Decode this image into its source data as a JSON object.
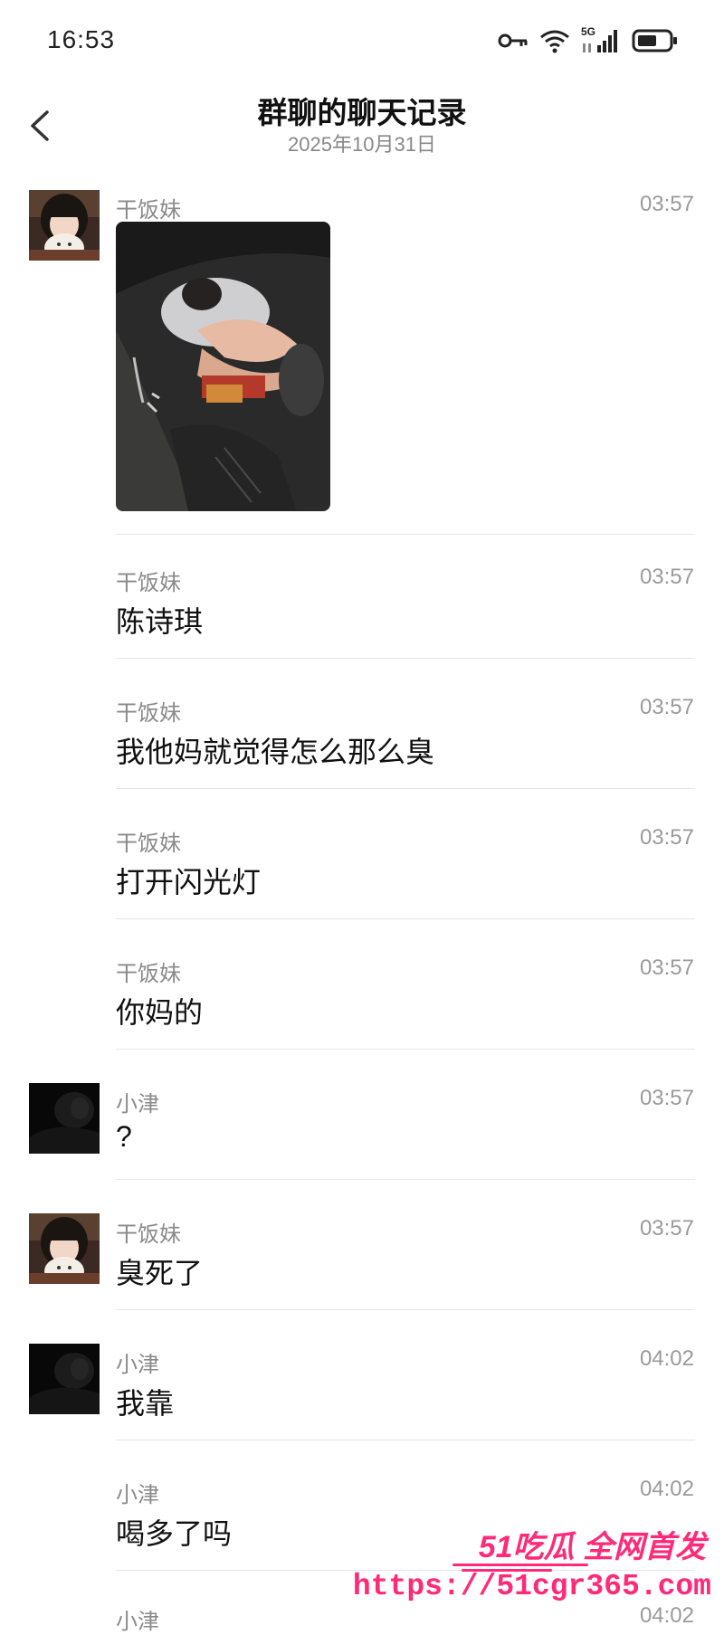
{
  "status_bar": {
    "time": "16:53",
    "icons": [
      "key-icon",
      "wifi-icon",
      "signal-5g-icon",
      "battery-icon"
    ],
    "network_label": "5G"
  },
  "header": {
    "back_icon": "chevron-left-icon",
    "title": "群聊的聊天记录",
    "date": "2025年10月31日"
  },
  "messages": [
    {
      "sender": "干饭妹",
      "time": "03:57",
      "type": "image",
      "text": ""
    },
    {
      "sender": "干饭妹",
      "time": "03:57",
      "type": "text",
      "text": "陈诗琪"
    },
    {
      "sender": "干饭妹",
      "time": "03:57",
      "type": "text",
      "text": "我他妈就觉得怎么那么臭"
    },
    {
      "sender": "干饭妹",
      "time": "03:57",
      "type": "text",
      "text": "打开闪光灯"
    },
    {
      "sender": "干饭妹",
      "time": "03:57",
      "type": "text",
      "text": "你妈的"
    },
    {
      "sender": "小津",
      "time": "03:57",
      "type": "text",
      "text": "?"
    },
    {
      "sender": "干饭妹",
      "time": "03:57",
      "type": "text",
      "text": "臭死了"
    },
    {
      "sender": "小津",
      "time": "04:02",
      "type": "text",
      "text": "我靠"
    },
    {
      "sender": "小津",
      "time": "04:02",
      "type": "text",
      "text": "喝多了吗"
    },
    {
      "sender": "小津",
      "time": "04:02",
      "type": "text",
      "text": ""
    }
  ],
  "watermark": {
    "brand": "51吃瓜 全网首发",
    "url": "https://51cgr365.com"
  },
  "colors": {
    "accent_watermark": "#ff2a7a",
    "meta_text": "#8a8a8a",
    "divider": "#e6e6e6"
  }
}
